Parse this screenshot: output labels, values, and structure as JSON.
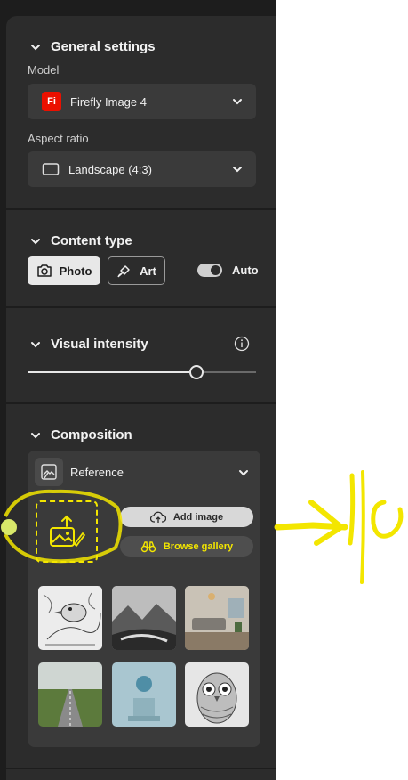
{
  "general": {
    "title": "General settings",
    "model_label": "Model",
    "model_value": "Firefly Image 4",
    "model_badge": "Fi",
    "aspect_label": "Aspect ratio",
    "aspect_value": "Landscape (4:3)"
  },
  "content_type": {
    "title": "Content type",
    "options": [
      "Photo",
      "Art"
    ],
    "selected": "Photo",
    "auto_label": "Auto",
    "auto_on": true
  },
  "visual_intensity": {
    "title": "Visual intensity",
    "level": 0.74
  },
  "composition": {
    "title": "Composition",
    "reference_label": "Reference",
    "add_image_label": "Add image",
    "browse_gallery_label": "Browse gallery",
    "gallery": [
      "bird sketch",
      "misty mountains",
      "living room",
      "road through fields",
      "sphere on cube",
      "owl drawing"
    ]
  },
  "colors": {
    "panel_bg": "#2c2c2c",
    "field_bg": "#3a3a3a",
    "annotation_yellow": "#f3e600",
    "firefly_red": "#eb1000"
  }
}
